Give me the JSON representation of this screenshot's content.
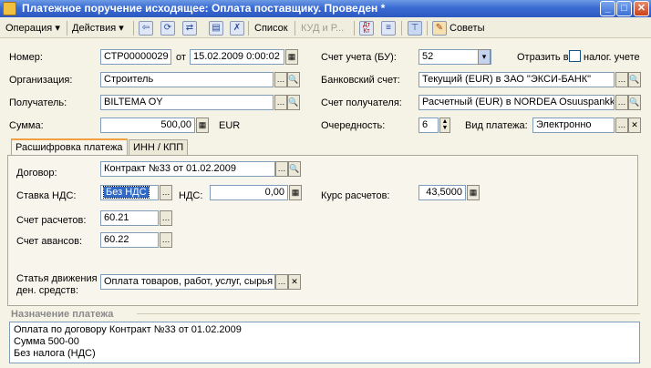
{
  "window": {
    "title": "Платежное поручение исходящее: Оплата поставщику. Проведен *"
  },
  "toolbar": {
    "operation": "Операция",
    "actions": "Действия",
    "list": "Список",
    "kud": "КУД и Р...",
    "tips": "Советы",
    "dt_kt": "Дт Кт"
  },
  "header": {
    "number_label": "Номер:",
    "number": "СТР00000029",
    "from_label": "от",
    "date": "15.02.2009  0:00:02",
    "org_label": "Организация:",
    "org": "Строитель",
    "recipient_label": "Получатель:",
    "recipient": "BILTEMA OY",
    "sum_label": "Сумма:",
    "sum": "500,00",
    "currency": "EUR",
    "account_bu_label": "Счет учета (БУ):",
    "account_bu": "52",
    "reflect_label": "Отразить в:",
    "tax_label": "налог. учете",
    "bank_account_label": "Банковский счет:",
    "bank_account": "Текущий (EUR) в ЗАО \"ЭКСИ-БАНК\"",
    "recipient_account_label": "Счет получателя:",
    "recipient_account": "Расчетный (EUR) в NORDEA Osuuspankki",
    "priority_label": "Очередность:",
    "priority": "6",
    "payment_type_label": "Вид платежа:",
    "payment_type": "Электронно"
  },
  "tabs": [
    {
      "label": "Расшифровка платежа"
    },
    {
      "label": "ИНН / КПП"
    }
  ],
  "details": {
    "contract_label": "Договор:",
    "contract": "Контракт №33 от 01.02.2009",
    "vat_rate_label": "Ставка НДС:",
    "vat_rate": "Без НДС",
    "vat_label": "НДС:",
    "vat": "0,00",
    "rate_label": "Курс расчетов:",
    "rate": "43,5000",
    "settle_account_label": "Счет расчетов:",
    "settle_account": "60.21",
    "advance_account_label": "Счет авансов:",
    "advance_account": "60.22",
    "cashflow_label_1": "Статья движения",
    "cashflow_label_2": "ден. средств:",
    "cashflow": "Оплата товаров, работ, услуг, сырья"
  },
  "purpose": {
    "title": "Назначение платежа",
    "lines": [
      "Оплата по договору Контракт №33 от 01.02.2009",
      "Сумма 500-00",
      "Без налога (НДС)"
    ]
  }
}
